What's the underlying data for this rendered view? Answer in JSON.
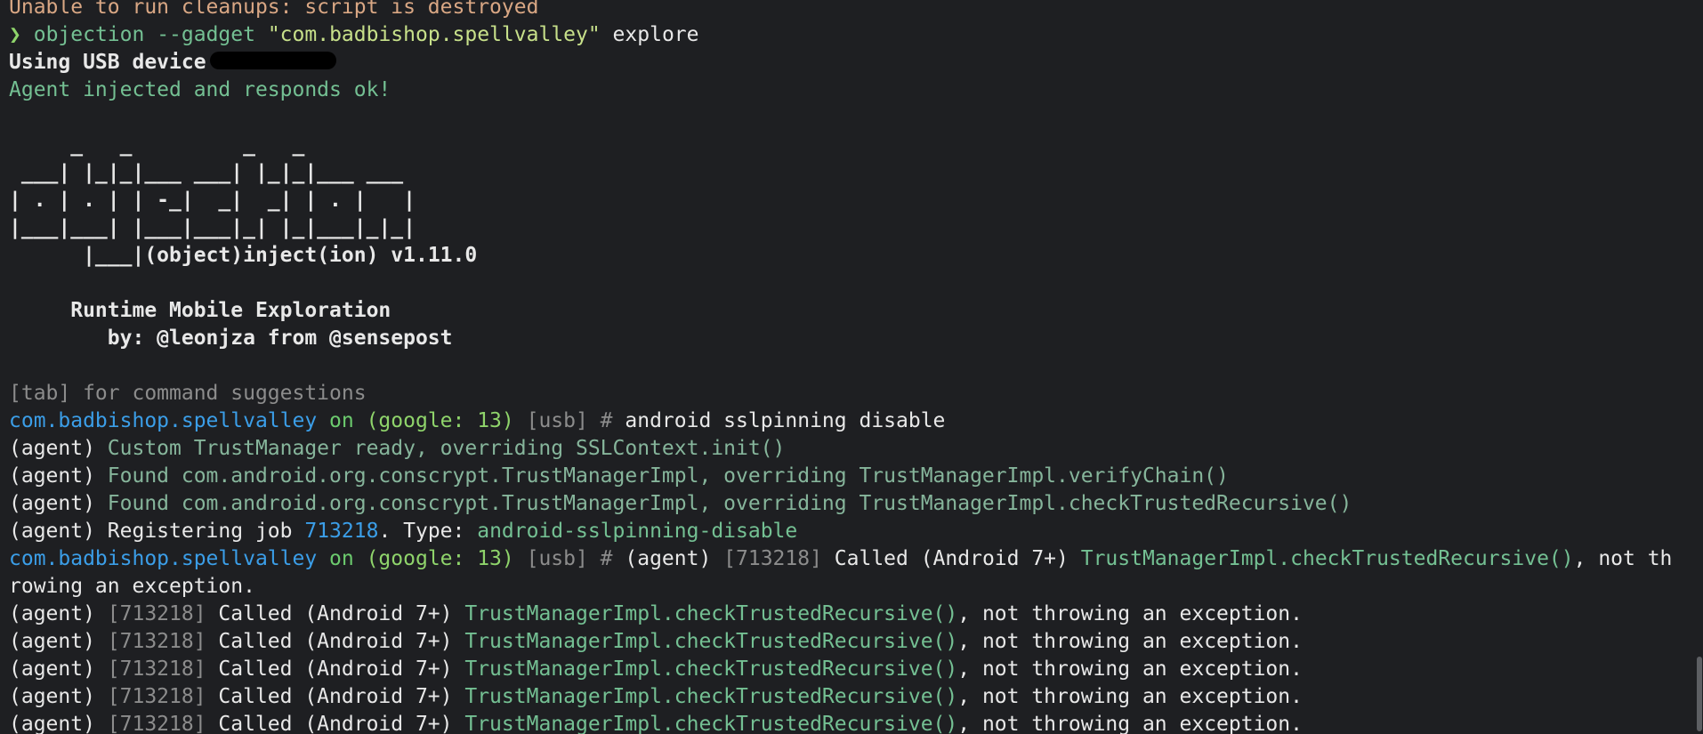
{
  "terminal": {
    "line_cleanup": "Unable to run cleanups: script is destroyed",
    "prompt_glyph": "❯",
    "cmd_prefix": "objection --gadget ",
    "cmd_package": "\"com.badbishop.spellvalley\"",
    "cmd_suffix": " explore",
    "usb_label": "Using USB device",
    "agent_ok": "Agent injected and responds ok!",
    "banner": [
      "     _   _         _   _",
      " ___| |_|_|___ ___| |_|_|___ ___",
      "| . | . | | -_|  _|  _| | . |   |",
      "|___|___| |___|___|_| |_|___|_|_|"
    ],
    "banner_tail_left": "      |___|",
    "banner_tail_right": "(object)inject(ion) v1.11.0",
    "runtime_title": "     Runtime Mobile Exploration",
    "byline": "        by: @leonjza from @sensepost",
    "tab_hint": "[tab] for command suggestions",
    "prompt": {
      "package": "com.badbishop.spellvalley",
      "on": " on ",
      "device": "(google: 13)",
      "transport": " [usb] # "
    },
    "cmd_sslpinning": "android sslpinning disable",
    "agent_tag": "(agent) ",
    "agent_custom_tm": "Custom TrustManager ready, overriding SSLContext.init()",
    "agent_found_1": "Found com.android.org.conscrypt.TrustManagerImpl, overriding TrustManagerImpl.verifyChain()",
    "agent_found_2": "Found com.android.org.conscrypt.TrustManagerImpl, overriding TrustManagerImpl.checkTrustedRecursive()",
    "register_prefix": "Registering job ",
    "job_id": "713218",
    "register_type_label": ". Type: ",
    "register_type": "android-sslpinning-disable",
    "job_tag": "[713218]",
    "called_prefix": " Called (Android 7+) ",
    "called_method": "TrustManagerImpl.checkTrustedRecursive()",
    "called_suffix_wrap": ", not th",
    "called_wrap_rest": "rowing an exception.",
    "called_suffix": ", not throwing an exception."
  }
}
